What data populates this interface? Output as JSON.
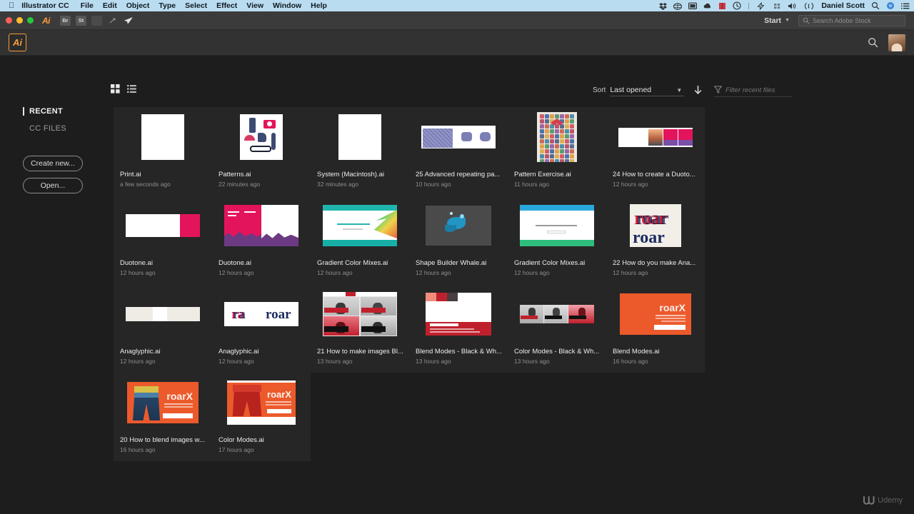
{
  "macbar": {
    "apple_icon": "apple-icon",
    "app_name": "Illustrator CC",
    "menus": [
      "File",
      "Edit",
      "Object",
      "Type",
      "Select",
      "Effect",
      "View",
      "Window",
      "Help"
    ],
    "status_icons": [
      "dropbox-icon",
      "cloud-icon",
      "display-icon",
      "weather-icon",
      "recording-icon",
      "time-machine-icon",
      "separator-icon",
      "battery-icon",
      "grid-icon",
      "volume-icon",
      "bluetooth-icon"
    ],
    "user_name": "Daniel Scott",
    "right_icons": [
      "spotlight-search-icon",
      "siri-icon",
      "notification-center-icon"
    ]
  },
  "appbar": {
    "app_badge": "Ai",
    "tool_buttons": [
      "Br",
      "St",
      "library-icon",
      "arrange-icon",
      "share-icon"
    ],
    "workspace": "Start",
    "stock_search_placeholder": "Search Adobe Stock"
  },
  "header": {
    "logo": "Ai",
    "search_icon": "search-icon",
    "avatar": "user-avatar"
  },
  "sidebar": {
    "items": [
      {
        "label": "RECENT",
        "active": true
      },
      {
        "label": "CC FILES",
        "active": false
      }
    ],
    "buttons": [
      {
        "label": "Create new..."
      },
      {
        "label": "Open..."
      }
    ]
  },
  "toolbar": {
    "grid_view_icon": "grid-view-icon",
    "list_view_icon": "list-view-icon",
    "sort_label": "Sort",
    "sort_value": "Last opened",
    "sort_direction_icon": "sort-descending-icon",
    "filter_icon": "filter-icon",
    "filter_placeholder": "Filter recent files"
  },
  "files": [
    {
      "name": "Print.ai",
      "time": "a few seconds ago",
      "thumb": "blank-portrait"
    },
    {
      "name": "Patterns.ai",
      "time": "22 minutes ago",
      "thumb": "pattern-icons"
    },
    {
      "name": "System (Macintosh).ai",
      "time": "32 minutes ago",
      "thumb": "blank-portrait"
    },
    {
      "name": "25 Advanced repeating pa...",
      "time": "10 hours ago",
      "thumb": "purple-pattern"
    },
    {
      "name": "Pattern Exercise.ai",
      "time": "11 hours ago",
      "thumb": "icon-poster"
    },
    {
      "name": "24 How to create a Duoto...",
      "time": "12 hours ago",
      "thumb": "duotone-strip"
    },
    {
      "name": "Duotone.ai",
      "time": "12 hours ago",
      "thumb": "pink-block"
    },
    {
      "name": "Duotone.ai",
      "time": "12 hours ago",
      "thumb": "duotone-city"
    },
    {
      "name": "Gradient Color Mixes.ai",
      "time": "12 hours ago",
      "thumb": "teal-website"
    },
    {
      "name": "Shape Builder Whale.ai",
      "time": "12 hours ago",
      "thumb": "whale-dark"
    },
    {
      "name": "Gradient Color Mixes.ai",
      "time": "12 hours ago",
      "thumb": "blue-website"
    },
    {
      "name": "22 How do you make Ana...",
      "time": "12 hours ago",
      "thumb": "roar-anaglyph"
    },
    {
      "name": "Anaglyphic.ai",
      "time": "12 hours ago",
      "thumb": "cream-bar"
    },
    {
      "name": "Anaglyphic.ai",
      "time": "12 hours ago",
      "thumb": "roar-pair"
    },
    {
      "name": "21 How to make images Bl...",
      "time": "13 hours ago",
      "thumb": "portrait-grid"
    },
    {
      "name": "Blend Modes - Black & Wh...",
      "time": "13 hours ago",
      "thumb": "red-card"
    },
    {
      "name": "Color Modes - Black & Wh...",
      "time": "13 hours ago",
      "thumb": "portrait-row"
    },
    {
      "name": "Blend Modes.ai",
      "time": "16 hours ago",
      "thumb": "roarx-plain"
    },
    {
      "name": "20 How to blend images w...",
      "time": "16 hours ago",
      "thumb": "roarx-legs"
    },
    {
      "name": "Color Modes.ai",
      "time": "17 hours ago",
      "thumb": "roarx-red"
    }
  ],
  "watermark": {
    "label": "Udemy"
  },
  "colors": {
    "menubar": "#b9dcf0",
    "appbar": "#3b3b3b",
    "header": "#323232",
    "background": "#1d1d1d",
    "card": "#262626",
    "accent_orange": "#f79e38",
    "duotone_pink": "#e4145c",
    "roarx_orange": "#ec5a2c"
  }
}
